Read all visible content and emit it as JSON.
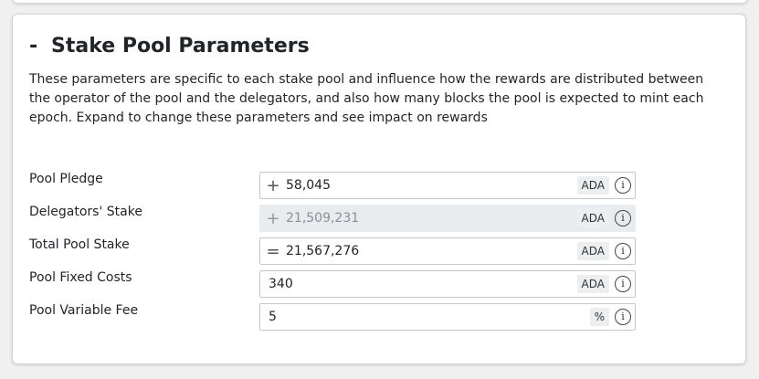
{
  "section": {
    "collapse_symbol": "-",
    "title": "Stake Pool Parameters",
    "description": "These parameters are specific to each stake pool and influence how the rewards are distributed between the operator of the pool and the delegators, and also how many blocks the pool is expected to mint each epoch. Expand to change these parameters and see impact on rewards"
  },
  "params": [
    {
      "label": "Pool Pledge",
      "prefix": "+",
      "value": "58,045",
      "unit": "ADA",
      "disabled": false
    },
    {
      "label": "Delegators' Stake",
      "prefix": "+",
      "value": "21,509,231",
      "unit": "ADA",
      "disabled": true
    },
    {
      "label": "Total Pool Stake",
      "prefix": "=",
      "value": "21,567,276",
      "unit": "ADA",
      "disabled": false
    },
    {
      "label": "Pool Fixed Costs",
      "prefix": "",
      "value": "340",
      "unit": "ADA",
      "disabled": false
    },
    {
      "label": "Pool Variable Fee",
      "prefix": "",
      "value": "5",
      "unit": "%",
      "disabled": false
    }
  ],
  "info_glyph": "i"
}
